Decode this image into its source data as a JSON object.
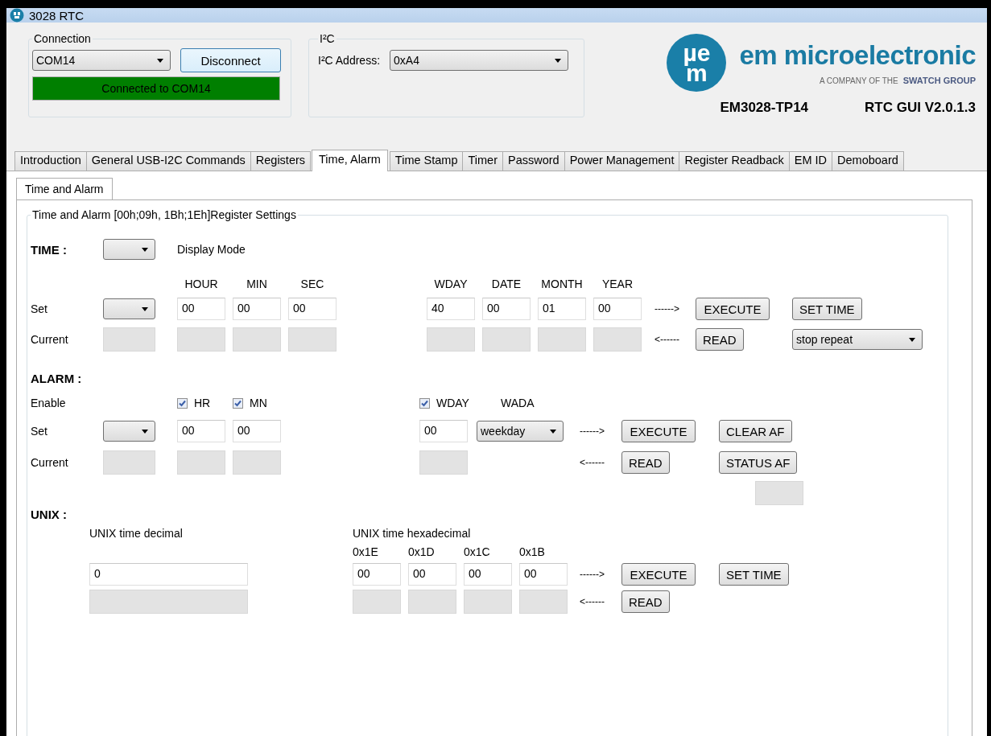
{
  "window": {
    "title": "3028 RTC"
  },
  "connection": {
    "label": "Connection",
    "port": "COM14",
    "button": "Disconnect",
    "status": "Connected to COM14",
    "connected": true
  },
  "i2c": {
    "label": "I²C",
    "address_label": "I²C Address:",
    "address": "0xA4"
  },
  "logo": {
    "mark_top": "µe",
    "mark_bottom": "m",
    "name": "em microelectronic",
    "tagline": "A COMPANY OF THE",
    "group": "SWATCH GROUP"
  },
  "device": "EM3028-TP14",
  "version": "RTC GUI V2.0.1.3",
  "tabs": [
    {
      "label": "Introduction",
      "selected": false
    },
    {
      "label": "General USB-I2C Commands",
      "selected": false
    },
    {
      "label": "Registers",
      "selected": false
    },
    {
      "label": "Time, Alarm",
      "selected": true
    },
    {
      "label": "Time Stamp",
      "selected": false
    },
    {
      "label": "Timer",
      "selected": false
    },
    {
      "label": "Password",
      "selected": false
    },
    {
      "label": "Power Management",
      "selected": false
    },
    {
      "label": "Register Readback",
      "selected": false
    },
    {
      "label": "EM ID",
      "selected": false
    },
    {
      "label": "Demoboard",
      "selected": false
    }
  ],
  "subtabs": [
    {
      "label": "Time and Alarm",
      "selected": true
    }
  ],
  "group_title": "Time and Alarm [00h;09h, 1Bh;1Eh]Register Settings",
  "time": {
    "heading": "TIME :",
    "display_mode_label": "Display Mode",
    "set_label": "Set",
    "current_label": "Current",
    "clock_fields": [
      {
        "label": "HOUR",
        "value": "00"
      },
      {
        "label": "MIN",
        "value": "00"
      },
      {
        "label": "SEC",
        "value": "00"
      }
    ],
    "date_fields": [
      {
        "label": "WDAY",
        "value": "40"
      },
      {
        "label": "DATE",
        "value": "00"
      },
      {
        "label": "MONTH",
        "value": "01"
      },
      {
        "label": "YEAR",
        "value": "00"
      }
    ],
    "write_arrow": "------>",
    "read_arrow": "<------",
    "execute": "EXECUTE",
    "read": "READ",
    "set_time": "SET TIME",
    "repeat": "stop repeat"
  },
  "alarm": {
    "heading": "ALARM :",
    "enable_label": "Enable",
    "set_label": "Set",
    "current_label": "Current",
    "enables": [
      {
        "label": "HR",
        "checked": true,
        "value": "00"
      },
      {
        "label": "MN",
        "checked": true,
        "value": "00"
      }
    ],
    "wday": {
      "label": "WDAY",
      "checked": true,
      "value": "00"
    },
    "wada_label": "WADA",
    "wada": "weekday",
    "write_arrow": "------>",
    "read_arrow": "<------",
    "execute": "EXECUTE",
    "read": "READ",
    "clear_af": "CLEAR AF",
    "status_af": "STATUS AF"
  },
  "unix": {
    "heading": "UNIX :",
    "decimal_label": "UNIX time decimal",
    "decimal": "0",
    "hex_label": "UNIX time hexadecimal",
    "hex": [
      {
        "label": "0x1E",
        "value": "00"
      },
      {
        "label": "0x1D",
        "value": "00"
      },
      {
        "label": "0x1C",
        "value": "00"
      },
      {
        "label": "0x1B",
        "value": "00"
      }
    ],
    "write_arrow": "------>",
    "read_arrow": "<------",
    "execute": "EXECUTE",
    "read": "READ",
    "set_time": "SET TIME"
  }
}
